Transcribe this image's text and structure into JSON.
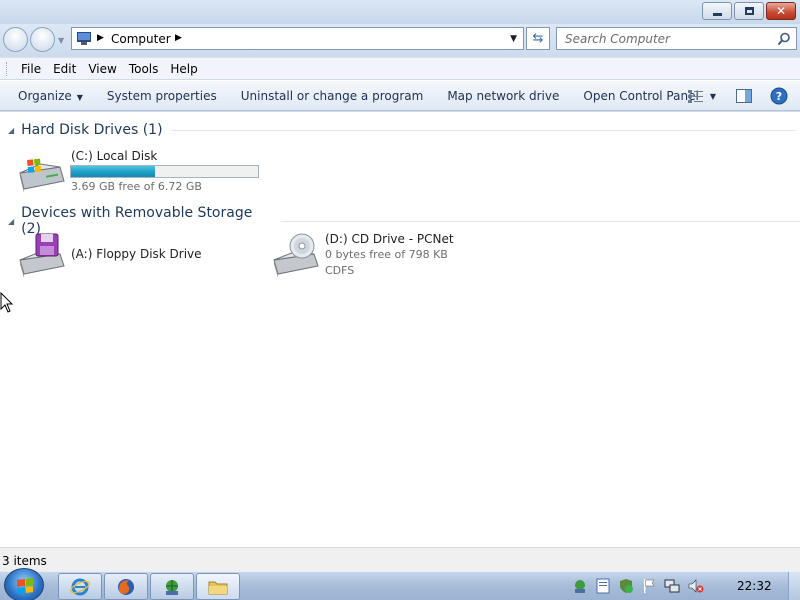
{
  "window": {
    "minimize_label": "",
    "maximize_label": "",
    "close_label": ""
  },
  "address": {
    "crumb": "Computer"
  },
  "search": {
    "placeholder": "Search Computer"
  },
  "menu": {
    "items": [
      "File",
      "Edit",
      "View",
      "Tools",
      "Help"
    ]
  },
  "commands": {
    "organize": "Organize",
    "system_properties": "System properties",
    "uninstall": "Uninstall or change a program",
    "map_drive": "Map network drive",
    "control_panel": "Open Control Panel"
  },
  "groups": {
    "hard_disks": {
      "title": "Hard Disk Drives (1)"
    },
    "removable": {
      "title": "Devices with Removable Storage (2)"
    }
  },
  "drives": {
    "c": {
      "name": "(C:) Local Disk",
      "free_text": "3.69 GB free of 6.72 GB",
      "used_fraction": 0.45
    },
    "a": {
      "name": "(A:) Floppy Disk Drive"
    },
    "d": {
      "name": "(D:) CD Drive - PCNet",
      "free_text": "0 bytes free of 798 KB",
      "fs": "CDFS"
    }
  },
  "status": {
    "items": "3 items"
  },
  "taskbar": {
    "clock": "22:32",
    "buttons": [
      "internet-explorer-icon",
      "firefox-icon",
      "network-globe-icon",
      "folder-icon"
    ]
  },
  "colors": {
    "bar_fill": "#1e9ec4",
    "group_heading": "#1e395b"
  }
}
